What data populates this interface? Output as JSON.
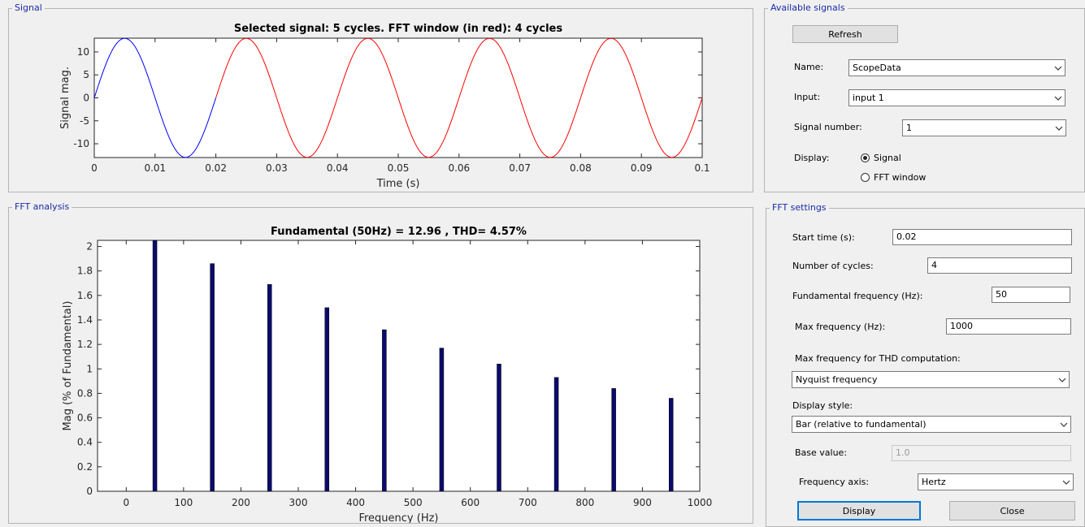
{
  "signal_panel": {
    "title": "Signal"
  },
  "fft_panel": {
    "title": "FFT analysis"
  },
  "available_panel": {
    "title": "Available signals",
    "refresh": "Refresh",
    "name_label": "Name:",
    "name_value": "ScopeData",
    "input_label": "Input:",
    "input_value": "input 1",
    "signal_number_label": "Signal number:",
    "signal_number_value": "1",
    "display_label": "Display:",
    "display_options": [
      "Signal",
      "FFT window"
    ],
    "display_selected": "Signal"
  },
  "fft_settings": {
    "title": "FFT settings",
    "start_time_label": "Start time (s):",
    "start_time_value": "0.02",
    "cycles_label": "Number of cycles:",
    "cycles_value": "4",
    "fund_freq_label": "Fundamental frequency (Hz):",
    "fund_freq_value": "50",
    "max_freq_label": "Max frequency (Hz):",
    "max_freq_value": "1000",
    "thd_label": "Max frequency for THD computation:",
    "thd_value": "Nyquist frequency",
    "display_style_label": "Display style:",
    "display_style_value": "Bar (relative to fundamental)",
    "base_value_label": "Base value:",
    "base_value_value": "1.0",
    "freq_axis_label": "Frequency axis:",
    "freq_axis_value": "Hertz",
    "display_button": "Display",
    "close_button": "Close"
  },
  "colors": {
    "first_cycle": "#0000ff",
    "fft_window": "#ff0000",
    "bars": "#0a0a6e",
    "panel_title": "#1a2aa6"
  },
  "chart_data": [
    {
      "type": "line",
      "title": "Selected signal: 5 cycles. FFT window (in red): 4 cycles",
      "xlabel": "Time (s)",
      "ylabel": "Signal mag.",
      "xlim": [
        0,
        0.1
      ],
      "ylim": [
        -13,
        13
      ],
      "xticks": [
        "0",
        "0.01",
        "0.02",
        "0.03",
        "0.04",
        "0.05",
        "0.06",
        "0.07",
        "0.08",
        "0.09",
        "0.1"
      ],
      "yticks": [
        "-10",
        "-5",
        "0",
        "5",
        "10"
      ],
      "amplitude": 12.96,
      "frequency_hz": 50,
      "series": [
        {
          "x": [
            0,
            0.02
          ]
        },
        {
          "x": [
            0.02,
            0.1
          ]
        }
      ]
    },
    {
      "type": "bar",
      "title": "Fundamental (50Hz) = 12.96 , THD= 4.57%",
      "xlabel": "Frequency (Hz)",
      "ylabel": "Mag (% of Fundamental)",
      "xlim": [
        -50,
        1000
      ],
      "ylim": [
        0,
        2.05
      ],
      "xticks": [
        "0",
        "100",
        "200",
        "300",
        "400",
        "500",
        "600",
        "700",
        "800",
        "900",
        "1000"
      ],
      "yticks": [
        "0",
        "0.2",
        "0.4",
        "0.6",
        "0.8",
        "1",
        "1.2",
        "1.4",
        "1.6",
        "1.8",
        "2"
      ],
      "x": [
        50,
        150,
        250,
        350,
        450,
        550,
        650,
        750,
        850,
        950
      ],
      "values": [
        2.05,
        1.86,
        1.69,
        1.5,
        1.32,
        1.17,
        1.04,
        0.93,
        0.84,
        0.76
      ]
    }
  ]
}
